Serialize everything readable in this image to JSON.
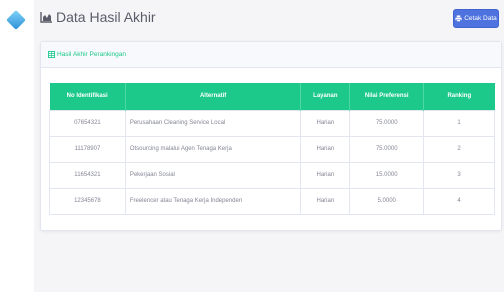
{
  "header": {
    "title": "Data Hasil Akhir",
    "print_label": "Cetak Data"
  },
  "card": {
    "title": "Hasil Akhir Perankingan"
  },
  "table": {
    "columns": [
      "No Identifikasi",
      "Alternatif",
      "Layanan",
      "Nilai Preferensi",
      "Ranking"
    ],
    "rows": [
      [
        "07654321",
        "Perusahaan Cleaning Service Local",
        "Harian",
        "75.0000",
        "1"
      ],
      [
        "11178907",
        "Otsourcing malalui Agen Tenaga Kerja",
        "Harian",
        "75.0000",
        "2"
      ],
      [
        "11654321",
        "Pekerjaan Sosial",
        "Harian",
        "15.0000",
        "3"
      ],
      [
        "12345678",
        "Freelencer atau Tenaga Kerja Independen",
        "Harian",
        "5.0000",
        "4"
      ]
    ]
  },
  "colors": {
    "primary": "#4e73df",
    "success": "#1cc88a"
  }
}
